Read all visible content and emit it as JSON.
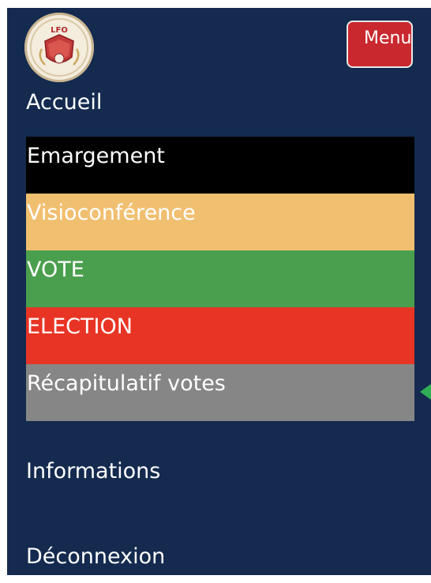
{
  "logo": {
    "text": "LFO",
    "colors": {
      "ring": "#c9b590",
      "shield": "#c23a3a",
      "background": "#f4ecdd"
    }
  },
  "menu_button": {
    "label": "Menu",
    "color": "#c9282e"
  },
  "nav": {
    "accueil": "Accueil",
    "informations": "Informations",
    "deconnexion": "Déconnexion"
  },
  "submenu": {
    "items": [
      {
        "label": "Emargement",
        "bg": "#000000",
        "fg": "#ffffff"
      },
      {
        "label": "Visioconférence",
        "bg": "#f1bf70",
        "fg": "#ffffff"
      },
      {
        "label": "VOTE",
        "bg": "#4a9f4e",
        "fg": "#ffffff"
      },
      {
        "label": "ELECTION",
        "bg": "#e83424",
        "fg": "#ffffff"
      },
      {
        "label": "Récapitulatif votes",
        "bg": "#868686",
        "fg": "#ffffff"
      }
    ]
  },
  "theme": {
    "background": "#142a4f",
    "text": "#ffffff",
    "indicator": "#2fae55"
  },
  "indicator_icon": "triangle-left-icon"
}
